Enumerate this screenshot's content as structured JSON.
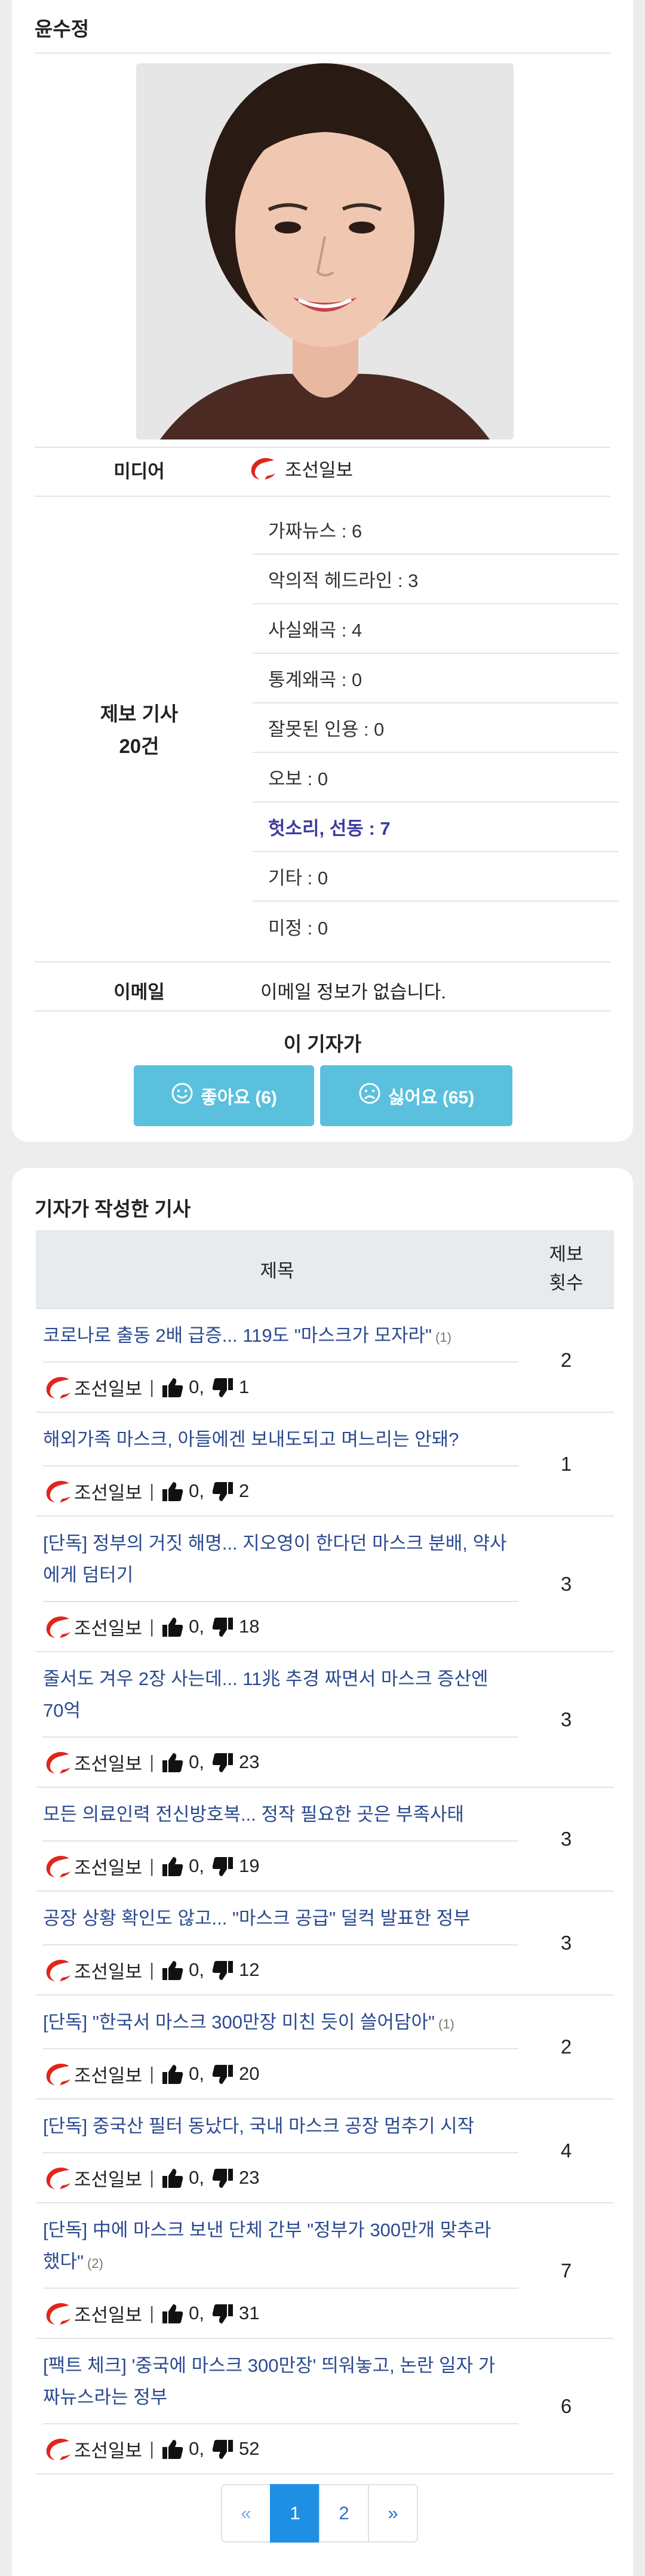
{
  "profile": {
    "name": "윤수정",
    "media_label": "미디어",
    "media_name": "조선일보",
    "reports_label_line1": "제보 기사",
    "reports_label_line2": "20건",
    "reports": [
      {
        "text": "가짜뉴스 : 6"
      },
      {
        "text": "악의적 헤드라인 : 3"
      },
      {
        "text": "사실왜곡 : 4"
      },
      {
        "text": "통계왜곡 : 0"
      },
      {
        "text": "잘못된 인용 : 0"
      },
      {
        "text": "오보 : 0"
      },
      {
        "text": "헛소리, 선동 : 7"
      },
      {
        "text": "기타 : 0"
      },
      {
        "text": "미정 : 0"
      }
    ],
    "email_label": "이메일",
    "email_value": "이메일 정보가 없습니다.",
    "reporter_title": "이 기자가",
    "like_label": "좋아요 (6)",
    "dislike_label": "싫어요 (65)"
  },
  "articles": {
    "section_title": "기자가 작성한 기사",
    "col_title": "제목",
    "col_count_line1": "제보",
    "col_count_line2": "횟수",
    "rows": [
      {
        "title": "코로나로 출동 2배 급증... 119도 \"마스크가 모자라\"",
        "badge": "(1)",
        "media": "조선일보",
        "likes": "0,",
        "dislikes": "1",
        "count": "2"
      },
      {
        "title": "해외가족 마스크, 아들에겐 보내도되고 며느리는 안돼?",
        "badge": "",
        "media": "조선일보",
        "likes": "0,",
        "dislikes": "2",
        "count": "1"
      },
      {
        "title": "[단독] 정부의 거짓 해명... 지오영이 한다던 마스크 분배, 약사에게 덤터기",
        "badge": "",
        "media": "조선일보",
        "likes": "0,",
        "dislikes": "18",
        "count": "3"
      },
      {
        "title": "줄서도 겨우 2장 사는데... 11兆 추경 짜면서 마스크 증산엔 70억",
        "badge": "",
        "media": "조선일보",
        "likes": "0,",
        "dislikes": "23",
        "count": "3"
      },
      {
        "title": "모든 의료인력 전신방호복... 정작 필요한 곳은 부족사태",
        "badge": "",
        "media": "조선일보",
        "likes": "0,",
        "dislikes": "19",
        "count": "3"
      },
      {
        "title": "공장 상황 확인도 않고... \"마스크 공급\" 덜컥 발표한 정부",
        "badge": "",
        "media": "조선일보",
        "likes": "0,",
        "dislikes": "12",
        "count": "3"
      },
      {
        "title": "[단독] \"한국서 마스크 300만장 미친 듯이 쓸어담아\"",
        "badge": "(1)",
        "media": "조선일보",
        "likes": "0,",
        "dislikes": "20",
        "count": "2"
      },
      {
        "title": "[단독] 중국산 필터 동났다, 국내 마스크 공장 멈추기 시작",
        "badge": "",
        "media": "조선일보",
        "likes": "0,",
        "dislikes": "23",
        "count": "4"
      },
      {
        "title": "[단독] 中에 마스크 보낸 단체 간부 \"정부가 300만개 맞추라 했다\"",
        "badge": "(2)",
        "media": "조선일보",
        "likes": "0,",
        "dislikes": "31",
        "count": "7"
      },
      {
        "title": "[팩트 체크] '중국에 마스크 300만장' 띄워놓고, 논란 일자 가짜뉴스라는 정부",
        "badge": "",
        "media": "조선일보",
        "likes": "0,",
        "dislikes": "52",
        "count": "6"
      }
    ]
  },
  "pagination": {
    "prev": "«",
    "pages": [
      "1",
      "2"
    ],
    "active": "1",
    "next": "»"
  },
  "colors": {
    "button": "#5bc0de",
    "link": "#2a4a8f",
    "highlight": "#3c3c9f",
    "active_page": "#1f8fe3",
    "logo_red": "#e1251b"
  },
  "icons": {
    "media_logo": "chosun-logo-icon",
    "like": "smile-icon",
    "dislike": "frown-icon",
    "thumbs_up": "thumbs-up-icon",
    "thumbs_down": "thumbs-down-icon"
  }
}
